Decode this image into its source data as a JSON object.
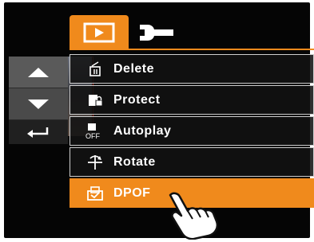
{
  "tabs": [
    {
      "id": "playback",
      "icon": "playback-icon",
      "active": true
    },
    {
      "id": "setup",
      "icon": "wrench-icon",
      "active": false
    }
  ],
  "side_buttons": {
    "up_icon": "arrow-up-icon",
    "down_icon": "arrow-down-icon",
    "back_icon": "return-icon"
  },
  "menu": {
    "items": [
      {
        "label": "Delete",
        "icon": "trash-icon"
      },
      {
        "label": "Protect",
        "icon": "protect-icon"
      },
      {
        "label": "Autoplay",
        "icon": "autoplay-icon",
        "icon_text": "OFF"
      },
      {
        "label": "Rotate",
        "icon": "rotate-icon"
      },
      {
        "label": "DPOF",
        "icon": "dpof-icon",
        "selected": true
      }
    ]
  },
  "colors": {
    "accent": "#f08a1c",
    "background": "#050505",
    "item_border": "#cfcfcf"
  }
}
